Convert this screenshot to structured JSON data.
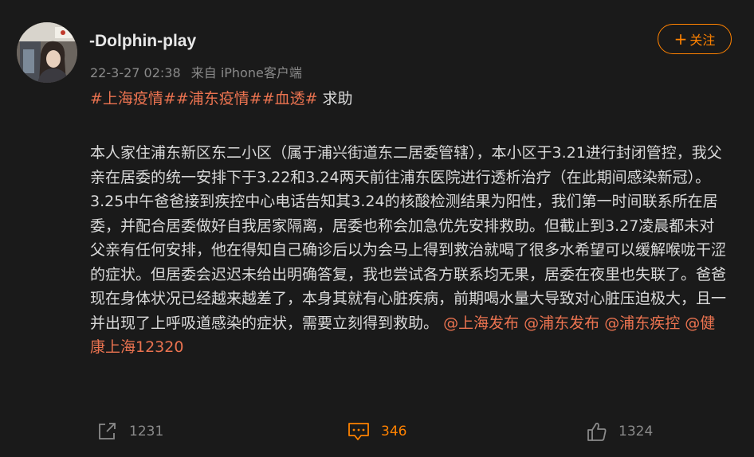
{
  "post": {
    "username": "-Dolphin-play",
    "timestamp": "22-3-27 02:38",
    "source": "来自 iPhone客户端",
    "follow_label": "关注",
    "follow_plus": "+",
    "tags": [
      "#上海疫情#",
      "#浦东疫情#",
      "#血透#"
    ],
    "tag_suffix": "求助",
    "body": "本人家住浦东新区东二小区（属于浦兴街道东二居委管辖），本小区于3.21进行封闭管控，我父亲在居委的统一安排下于3.22和3.24两天前往浦东医院进行透析治疗（在此期间感染新冠）。3.25中午爸爸接到疾控中心电话告知其3.24的核酸检测结果为阳性，我们第一时间联系所在居委，并配合居委做好自我居家隔离，居委也称会加急优先安排救助。但截止到3.27凌晨都未对父亲有任何安排，他在得知自己确诊后以为会马上得到救治就喝了很多水希望可以缓解喉咙干涩的症状。但居委会迟迟未给出明确答复，我也尝试各方联系均无果，居委在夜里也失联了。爸爸现在身体状况已经越来越差了，本身其就有心脏疾病，前期喝水量大导致对心脏压迫极大，且一并出现了上呼吸道感染的症状，需要立刻得到救助。",
    "mentions": [
      "@上海发布",
      "@浦东发布",
      "@浦东疾控",
      "@健康上海12320"
    ]
  },
  "actions": {
    "share_count": "1231",
    "comment_count": "346",
    "like_count": "1324"
  },
  "colors": {
    "background": "#1a1a1a",
    "accent": "#ff8200",
    "link": "#eb7350",
    "muted": "#8a8a8a",
    "text": "#d9d9d9"
  },
  "icons": {
    "share": "share-icon",
    "comment": "comment-icon",
    "like": "thumbs-up-icon"
  }
}
